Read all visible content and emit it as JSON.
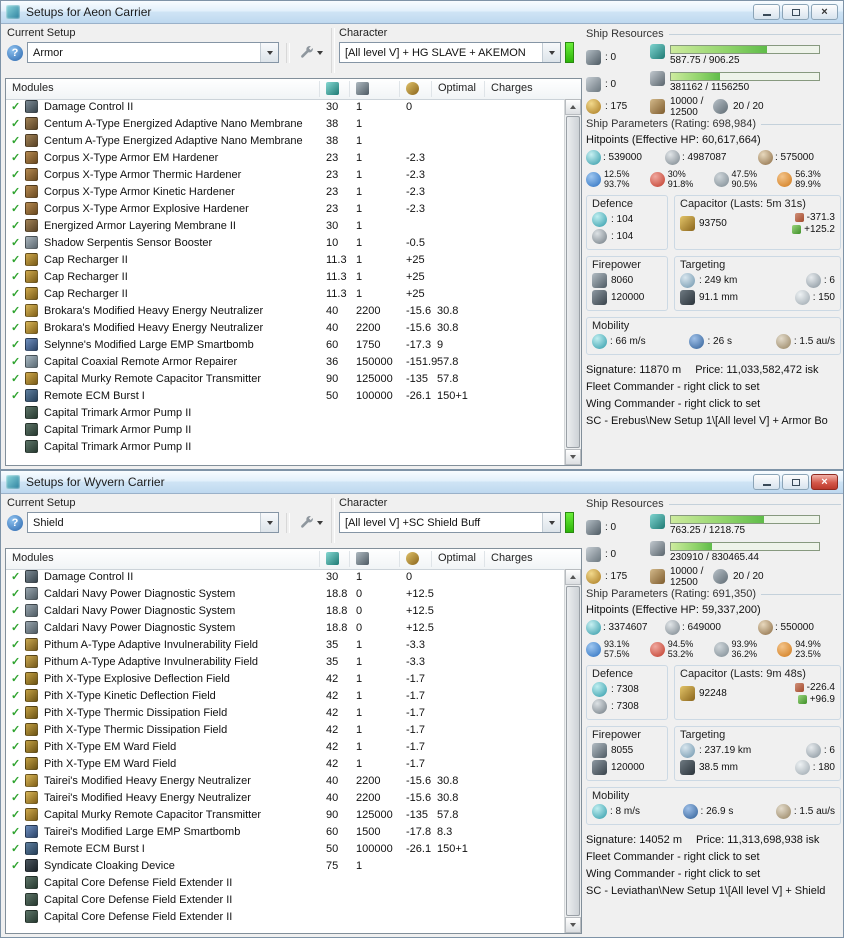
{
  "icons": {
    "help_glyph": "?",
    "close_glyph": "×",
    "check_glyph": "✓"
  },
  "colors": {
    "titlebar_blue": "#cfe4f5",
    "check_green": "#2fa32f",
    "character_bar_green": "#35d40c",
    "resource_bar_green": "#8fd36a",
    "close_button_red": "#bb3a2d"
  },
  "windows": [
    {
      "title": "Setups for Aeon Carrier",
      "active": false,
      "labels": {
        "current_setup": "Current Setup",
        "character": "Character",
        "modules": "Modules",
        "optimal": "Optimal",
        "charges": "Charges"
      },
      "current_setup_value": "Armor",
      "character_value": "[All level V] + HG SLAVE + AKEMON",
      "modules": [
        {
          "name": "Damage Control II",
          "icon": "dc",
          "cpu": "30",
          "pg": "1",
          "cap": "0",
          "optimal": ""
        },
        {
          "name": "Centum A-Type Energized Adaptive Nano Membrane",
          "icon": "membrane",
          "cpu": "38",
          "pg": "1",
          "cap": "",
          "optimal": ""
        },
        {
          "name": "Centum A-Type Energized Adaptive Nano Membrane",
          "icon": "membrane",
          "cpu": "38",
          "pg": "1",
          "cap": "",
          "optimal": ""
        },
        {
          "name": "Corpus X-Type Armor EM Hardener",
          "icon": "hardener",
          "cpu": "23",
          "pg": "1",
          "cap": "-2.3",
          "optimal": ""
        },
        {
          "name": "Corpus X-Type Armor Thermic Hardener",
          "icon": "hardener",
          "cpu": "23",
          "pg": "1",
          "cap": "-2.3",
          "optimal": ""
        },
        {
          "name": "Corpus X-Type Armor Kinetic Hardener",
          "icon": "hardener",
          "cpu": "23",
          "pg": "1",
          "cap": "-2.3",
          "optimal": ""
        },
        {
          "name": "Corpus X-Type Armor Explosive Hardener",
          "icon": "hardener",
          "cpu": "23",
          "pg": "1",
          "cap": "-2.3",
          "optimal": ""
        },
        {
          "name": "Energized Armor Layering Membrane II",
          "icon": "membrane",
          "cpu": "30",
          "pg": "1",
          "cap": "",
          "optimal": ""
        },
        {
          "name": "Shadow Serpentis Sensor Booster",
          "icon": "sensor",
          "cpu": "10",
          "pg": "1",
          "cap": "-0.5",
          "optimal": ""
        },
        {
          "name": "Cap Recharger II",
          "icon": "cap",
          "cpu": "11.3",
          "pg": "1",
          "cap": "+25",
          "optimal": ""
        },
        {
          "name": "Cap Recharger II",
          "icon": "cap",
          "cpu": "11.3",
          "pg": "1",
          "cap": "+25",
          "optimal": ""
        },
        {
          "name": "Cap Recharger II",
          "icon": "cap",
          "cpu": "11.3",
          "pg": "1",
          "cap": "+25",
          "optimal": ""
        },
        {
          "name": "Brokara's Modified Heavy Energy Neutralizer",
          "icon": "neut",
          "cpu": "40",
          "pg": "2200",
          "cap": "-15.6",
          "optimal": "30.8"
        },
        {
          "name": "Brokara's Modified Heavy Energy Neutralizer",
          "icon": "neut",
          "cpu": "40",
          "pg": "2200",
          "cap": "-15.6",
          "optimal": "30.8"
        },
        {
          "name": "Selynne's Modified Large EMP Smartbomb",
          "icon": "smart",
          "cpu": "60",
          "pg": "1750",
          "cap": "-17.3",
          "optimal": "9"
        },
        {
          "name": "Capital Coaxial Remote Armor Repairer",
          "icon": "rr",
          "cpu": "36",
          "pg": "150000",
          "cap": "-151.9",
          "optimal": "57.8"
        },
        {
          "name": "Capital Murky Remote Capacitor Transmitter",
          "icon": "cap",
          "cpu": "90",
          "pg": "125000",
          "cap": "-135",
          "optimal": "57.8"
        },
        {
          "name": "Remote ECM Burst I",
          "icon": "ecm",
          "cpu": "50",
          "pg": "100000",
          "cap": "-26.1",
          "optimal": "150+1"
        },
        {
          "name": "Capital Trimark Armor Pump II",
          "icon": "rig",
          "fitted": false,
          "cpu": "",
          "pg": "",
          "cap": "",
          "optimal": ""
        },
        {
          "name": "Capital Trimark Armor Pump II",
          "icon": "rig",
          "fitted": false,
          "cpu": "",
          "pg": "",
          "cap": "",
          "optimal": ""
        },
        {
          "name": "Capital Trimark Armor Pump II",
          "icon": "rig",
          "fitted": false,
          "cpu": "",
          "pg": "",
          "cap": "",
          "optimal": ""
        }
      ],
      "resources": {
        "title": "Ship Resources",
        "turrets": ": 0",
        "launchers": ": 0",
        "calibration": ": 175",
        "cpu": "587.75 / 906.25",
        "cpu_pct": 65,
        "power": "381162 / 1156250",
        "power_pct": 33,
        "cargo": "10000 / 12500",
        "drones": "20 / 20"
      },
      "parameters": {
        "title": "Ship Parameters (Rating: 698,984)",
        "hitpoints": "Hitpoints (Effective HP: 60,617,664)",
        "shield_hp": ": 539000",
        "armor_hp": ": 4987087",
        "hull_hp": ": 575000",
        "resists": [
          {
            "s": "12.5%",
            "a": "93.7%"
          },
          {
            "s": "30%",
            "a": "91.8%"
          },
          {
            "s": "47.5%",
            "a": "90.5%"
          },
          {
            "s": "56.3%",
            "a": "89.9%"
          }
        ],
        "defence": {
          "title": "Defence",
          "shield": ": 104",
          "armor": ": 104"
        },
        "capacitor": {
          "title": "Capacitor (Lasts: 5m 31s)",
          "amount": "93750",
          "out": "-371.3",
          "in": "+125.2"
        },
        "firepower": {
          "title": "Firepower",
          "dps": "8060",
          "volley": "120000"
        },
        "targeting": {
          "title": "Targeting",
          "range": ": 249 km",
          "targets": ": 6",
          "resolution": "91.1 mm",
          "scanres": ": 150"
        },
        "mobility": {
          "title": "Mobility",
          "speed": ": 66 m/s",
          "agility": ": 26 s",
          "warp": ": 1.5 au/s"
        },
        "signature": "Signature: 11870 m",
        "price": "Price: 11,033,582,472 isk",
        "fleet": "Fleet Commander - right click to set",
        "wing": "Wing Commander - right click to set",
        "sc": "SC - Erebus\\New Setup 1\\[All level V] + Armor Bo"
      }
    },
    {
      "title": "Setups for Wyvern Carrier",
      "active": true,
      "labels": {
        "current_setup": "Current Setup",
        "character": "Character",
        "modules": "Modules",
        "optimal": "Optimal",
        "charges": "Charges"
      },
      "current_setup_value": "Shield",
      "character_value": "[All level V] +SC Shield Buff",
      "modules": [
        {
          "name": "Damage Control II",
          "icon": "dc",
          "cpu": "30",
          "pg": "1",
          "cap": "0",
          "optimal": ""
        },
        {
          "name": "Caldari Navy Power Diagnostic System",
          "icon": "pds",
          "cpu": "18.8",
          "pg": "0",
          "cap": "+12.5",
          "optimal": ""
        },
        {
          "name": "Caldari Navy Power Diagnostic System",
          "icon": "pds",
          "cpu": "18.8",
          "pg": "0",
          "cap": "+12.5",
          "optimal": ""
        },
        {
          "name": "Caldari Navy Power Diagnostic System",
          "icon": "pds",
          "cpu": "18.8",
          "pg": "0",
          "cap": "+12.5",
          "optimal": ""
        },
        {
          "name": "Pithum A-Type Adaptive Invulnerability Field",
          "icon": "invuln",
          "cpu": "35",
          "pg": "1",
          "cap": "-3.3",
          "optimal": ""
        },
        {
          "name": "Pithum A-Type Adaptive Invulnerability Field",
          "icon": "invuln",
          "cpu": "35",
          "pg": "1",
          "cap": "-3.3",
          "optimal": ""
        },
        {
          "name": "Pith X-Type Explosive Deflection Field",
          "icon": "shieldh",
          "cpu": "42",
          "pg": "1",
          "cap": "-1.7",
          "optimal": ""
        },
        {
          "name": "Pith X-Type Kinetic Deflection Field",
          "icon": "shieldh",
          "cpu": "42",
          "pg": "1",
          "cap": "-1.7",
          "optimal": ""
        },
        {
          "name": "Pith X-Type Thermic Dissipation Field",
          "icon": "shieldh",
          "cpu": "42",
          "pg": "1",
          "cap": "-1.7",
          "optimal": ""
        },
        {
          "name": "Pith X-Type Thermic Dissipation Field",
          "icon": "shieldh",
          "cpu": "42",
          "pg": "1",
          "cap": "-1.7",
          "optimal": ""
        },
        {
          "name": "Pith X-Type EM Ward Field",
          "icon": "shieldh",
          "cpu": "42",
          "pg": "1",
          "cap": "-1.7",
          "optimal": ""
        },
        {
          "name": "Pith X-Type EM Ward Field",
          "icon": "shieldh",
          "cpu": "42",
          "pg": "1",
          "cap": "-1.7",
          "optimal": ""
        },
        {
          "name": "Tairei's Modified Heavy Energy Neutralizer",
          "icon": "neut",
          "cpu": "40",
          "pg": "2200",
          "cap": "-15.6",
          "optimal": "30.8"
        },
        {
          "name": "Tairei's Modified Heavy Energy Neutralizer",
          "icon": "neut",
          "cpu": "40",
          "pg": "2200",
          "cap": "-15.6",
          "optimal": "30.8"
        },
        {
          "name": "Capital Murky Remote Capacitor Transmitter",
          "icon": "cap",
          "cpu": "90",
          "pg": "125000",
          "cap": "-135",
          "optimal": "57.8"
        },
        {
          "name": "Tairei's Modified Large EMP Smartbomb",
          "icon": "smart",
          "cpu": "60",
          "pg": "1500",
          "cap": "-17.8",
          "optimal": "8.3"
        },
        {
          "name": "Remote ECM Burst I",
          "icon": "ecm",
          "cpu": "50",
          "pg": "100000",
          "cap": "-26.1",
          "optimal": "150+1"
        },
        {
          "name": "Syndicate Cloaking Device",
          "icon": "cloak",
          "cpu": "75",
          "pg": "1",
          "cap": "",
          "optimal": ""
        },
        {
          "name": "Capital Core Defense Field Extender II",
          "icon": "rig",
          "fitted": false,
          "cpu": "",
          "pg": "",
          "cap": "",
          "optimal": ""
        },
        {
          "name": "Capital Core Defense Field Extender II",
          "icon": "rig",
          "fitted": false,
          "cpu": "",
          "pg": "",
          "cap": "",
          "optimal": ""
        },
        {
          "name": "Capital Core Defense Field Extender II",
          "icon": "rig",
          "fitted": false,
          "cpu": "",
          "pg": "",
          "cap": "",
          "optimal": ""
        }
      ],
      "resources": {
        "title": "Ship Resources",
        "turrets": ": 0",
        "launchers": ": 0",
        "calibration": ": 175",
        "cpu": "763.25 / 1218.75",
        "cpu_pct": 63,
        "power": "230910 / 830465.44",
        "power_pct": 28,
        "cargo": "10000 / 12500",
        "drones": "20 / 20"
      },
      "parameters": {
        "title": "Ship Parameters (Rating: 691,350)",
        "hitpoints": "Hitpoints (Effective HP: 59,337,200)",
        "shield_hp": ": 3374607",
        "armor_hp": ": 649000",
        "hull_hp": ": 550000",
        "resists": [
          {
            "s": "93.1%",
            "a": "57.5%"
          },
          {
            "s": "94.5%",
            "a": "53.2%"
          },
          {
            "s": "93.9%",
            "a": "36.2%"
          },
          {
            "s": "94.9%",
            "a": "23.5%"
          }
        ],
        "defence": {
          "title": "Defence",
          "shield": ": 7308",
          "armor": ": 7308"
        },
        "capacitor": {
          "title": "Capacitor (Lasts: 9m 48s)",
          "amount": "92248",
          "out": "-226.4",
          "in": "+96.9"
        },
        "firepower": {
          "title": "Firepower",
          "dps": "8055",
          "volley": "120000"
        },
        "targeting": {
          "title": "Targeting",
          "range": ": 237.19 km",
          "targets": ": 6",
          "resolution": "38.5 mm",
          "scanres": ": 180"
        },
        "mobility": {
          "title": "Mobility",
          "speed": ": 8 m/s",
          "agility": ": 26.9 s",
          "warp": ": 1.5 au/s"
        },
        "signature": "Signature: 14052 m",
        "price": "Price: 11,313,698,938 isk",
        "fleet": "Fleet Commander - right click to set",
        "wing": "Wing Commander - right click to set",
        "sc": "SC - Leviathan\\New Setup 1\\[All level V] + Shield"
      }
    }
  ]
}
